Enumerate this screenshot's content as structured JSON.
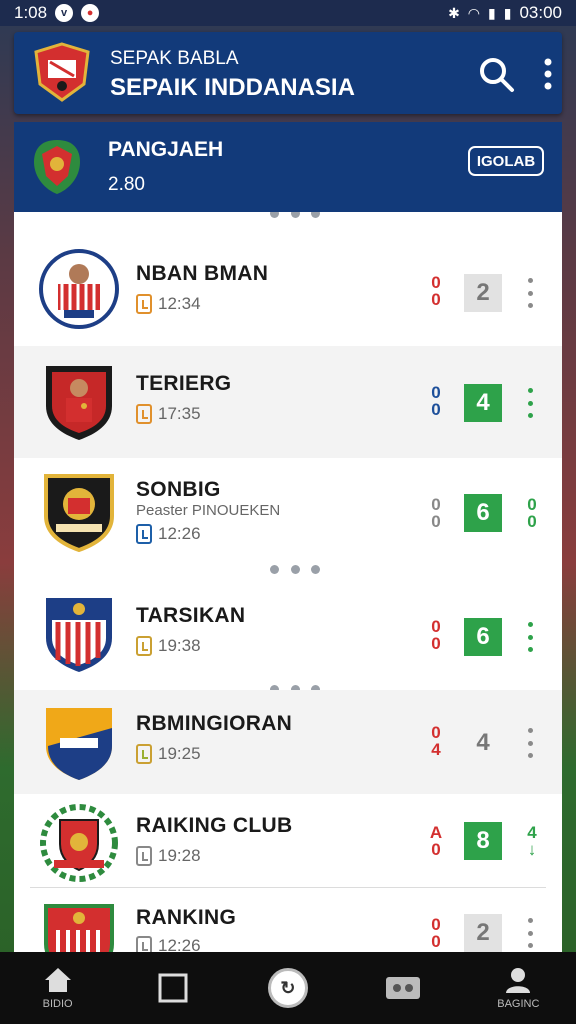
{
  "status_bar": {
    "time": "1:08",
    "clock_right": "03:00"
  },
  "app_bar": {
    "subtitle": "SEPAK BABLA",
    "title": "SEPAIK INDDANASIA"
  },
  "featured": {
    "name": "PANGJAEH",
    "value": "2.80",
    "button_label": "IGOLAB"
  },
  "rows": [
    {
      "name": "NBAN BMAN",
      "sub": "",
      "time": "12:34",
      "form_top": "0",
      "form_bottom": "0",
      "form_color": "#d32f2f",
      "score": "2",
      "score_style": "grey",
      "more_style": "grey"
    },
    {
      "name": "TERIERG",
      "sub": "",
      "time": "17:35",
      "form_top": "0",
      "form_bottom": "0",
      "form_color": "#1d4f9a",
      "score": "4",
      "score_style": "green",
      "more_style": "green"
    },
    {
      "name": "SONBIG",
      "sub": "Peaster PINOUEKEN",
      "time": "12:26",
      "form_top": "0",
      "form_bottom": "0",
      "form_color": "#888888",
      "score": "6",
      "score_style": "green",
      "more_style": "green"
    },
    {
      "name": "TARSIKAN",
      "sub": "",
      "time": "19:38",
      "form_top": "0",
      "form_bottom": "0",
      "form_color": "#d32f2f",
      "score": "6",
      "score_style": "green",
      "more_style": "green"
    },
    {
      "name": "RBMINGIORAN",
      "sub": "",
      "time": "19:25",
      "form_top": "0",
      "form_bottom": "4",
      "form_color": "#d32f2f",
      "score": "4",
      "score_style": "plain",
      "more_style": "grey"
    },
    {
      "name": "RAIKING CLUB",
      "sub": "",
      "time": "19:28",
      "form_top": "A",
      "form_bottom": "0",
      "form_color": "#d32f2f",
      "score": "8",
      "score_style": "green",
      "more_style": "green"
    },
    {
      "name": "RANKING",
      "sub": "",
      "time": "12:26",
      "form_top": "0",
      "form_bottom": "0",
      "form_color": "#d32f2f",
      "score": "2",
      "score_style": "grey",
      "more_style": "grey"
    }
  ],
  "nav": {
    "home_label": "BIDIO",
    "profile_label": "BAGINC"
  },
  "colors": {
    "primary": "#123a7a",
    "accent_green": "#2ea24a",
    "accent_red": "#d32f2f"
  }
}
